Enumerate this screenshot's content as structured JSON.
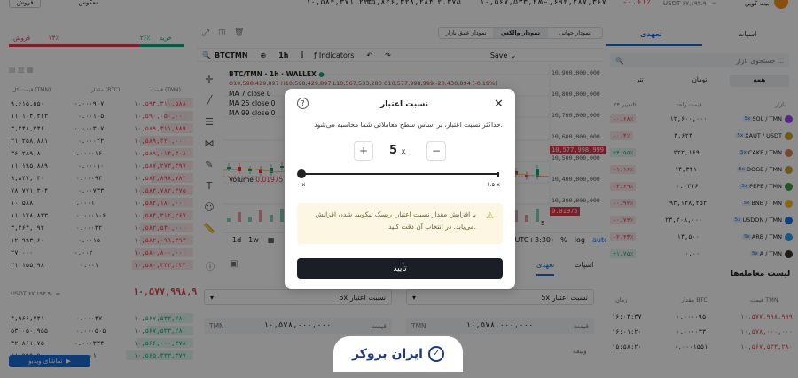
{
  "top_bar": {
    "left_btn1": "فروش",
    "left_btn2": "معکوس",
    "price1": "۱۰,۵۸۴,۳۷۱,۲۲۵",
    "price2": "۳۵,۸۲۶,۳۲۸,۲۸۴",
    "price3": "۲.۳۷۵",
    "price4": "۱۰,۵۶۷,۵۳۳,۲۸۰",
    "price5": "۱۰,۶۹۲,۲۸۷,۳۶۷",
    "change": "-۰.۶۱٪",
    "usdt_label": "USDT ۶۷,۱۹۳.۹۰ ≈",
    "pair_name": "بیت کوین",
    "pair_sub": "تومان /"
  },
  "orderbook": {
    "buy_label": "خرید",
    "sell_label": "فروش",
    "buy_pct": "۲۶٪",
    "sell_pct": "۷۴٪",
    "col_price": "قیمت (TMN)",
    "col_amount": "مقدار (BTC)",
    "col_total": "قیمت کل (TMN)",
    "asks": [
      [
        "۱۰,۵۹۴,۳۱۰,۵۸۸",
        "۰.۰۰۰۹۰۷",
        "۹,۶۱۵,۵۵۰"
      ],
      [
        "۱۰,۵۹۰,۰۵۰,۰۰۰",
        "۰.۰۰۱۰۵",
        "۱۱,۱۰۴,۳۶۳"
      ],
      [
        "۱۰,۵۸۹,۳۱۱,۸۸۹",
        "۰.۰۰۰۳۰۷",
        "۳,۲۴۸,۳۴۶"
      ],
      [
        "۱۰,۵۸۹,۲۲۰,۰۰۰",
        "۰.۰۰۰۲۲",
        "۲۱,۲۵۸,۸۸۱"
      ],
      [
        "۱۰,۵۸۹,۰۱۴,۳۰۸",
        "۰.۰۰۰۰۱۶",
        "۳۶,۲۸۹,۸"
      ],
      [
        "۱۰,۵۸۷,۲۷۳,۳۹۷",
        "۰.۰۰۰۱۰",
        "۱۱,۱۹۵,۸۸۹"
      ],
      [
        "۱۰,۵۸۴,۸۹۸,۷۸۲",
        "۰.۰۰۰۹۳",
        "۹,۸۴۷,۱۳۰"
      ],
      [
        "۱۰,۵۸۴,۷۸۲,۳۷۵",
        "۰.۰۰۷۳۳",
        "۷۸,۷۷۱,۳۰۴"
      ],
      [
        "۱۰,۵۸۴,۱۸۰,۰۰۰",
        "۰.۰۰۰۱",
        "۱۰,۵۸۸"
      ],
      [
        "۱۰,۵۸۴,۳۱۲,۲۶۷",
        "۰.۰۰۰۱۰۶",
        "۱۱,۱۷۸,۸۳۳"
      ],
      [
        "۱۰,۵۸۲,۵۴۰,۰۰۰",
        "۰.۰۰۰۳۲",
        "۳,۲۶۴,۰۹۲"
      ],
      [
        "۱۰,۵۸۲,۰۹۹,۳۹۴",
        "۰.۰۰۱۵",
        "۱۲,۹۹۳,۶۰"
      ],
      [
        "۱۰,۵۸۰,۸۰۰,۰۰۰",
        "۰.۰۰۲",
        "۲۷,۰۰۰"
      ],
      [
        "۱۰,۵۸۰,۳۳۳,۳۳۳",
        "۰.۰۰۱",
        "۲۱,۱۵۵,۹۸"
      ]
    ],
    "last_price": "۱۰,۵۷۷,۹۹۸,۹۹۹",
    "last_usdt": "USDT ۶۷,۱۹۳.۹۰ ≈",
    "bids": [
      [
        "۱۰,۵۶۷,۵۳۳,۲۸۰",
        "۰.۰۰۰۴۷",
        "۴,۹۶۶,۷۴۱"
      ],
      [
        "۱۰,۵۶۷,۵۳۳,۲۸۰",
        "۰.۰۰۰۵۰۵",
        "۵۳,۰۵۰,۹۵۵"
      ],
      [
        "۱۰,۵۶۶,۰۰۰,۳۷۸",
        "۰.۰۰۰۳۳۴",
        "۳۲,۸۶۱,۷۵"
      ],
      [
        "۱۰,۵۶۵,۳۳۳,۳۷۷",
        "۰.۰۰۱",
        "۸۱,۹۹۹,۹"
      ]
    ],
    "watch_btn": "تماشای ویدیو"
  },
  "chart": {
    "view_tabs": [
      "نمودار جهانی",
      "نمودار والکس",
      "نمودار عمق بازار"
    ],
    "active_view": "نمودار والکس",
    "symbol": "BTCTMN",
    "interval": "1h",
    "indicators": "Indicators",
    "save": "Save",
    "title": "BTC/TMN · 1h · WALLEX",
    "ohlc": "O10,598,429,897 H10,598,429,897 L10,567,533,280 C10,577,998,999 -20,430,894 (-0.19%)",
    "ma7": "MA 7 close 0",
    "ma25": "MA 25 close 0",
    "ma99": "MA 99 close 0",
    "volume": "Volume",
    "volume_val": "0.01975",
    "vol_tag": "0.01975",
    "price_axis": [
      "10,900,000,000",
      "10,800,000,000",
      "10,700,000,000",
      "10,600,000,000",
      "10,500,000,000",
      "10,400,000,000",
      "10,300,000,000"
    ],
    "price_tag": "10,577,998,999",
    "axis_5": "5",
    "ranges": [
      "1d",
      "1w"
    ],
    "time_label": "(UTC+3:30)",
    "pct": "%",
    "log": "log",
    "auto": "auto"
  },
  "market": {
    "tabs": [
      "اسپات",
      "تعهدی"
    ],
    "active_tab": "تعهدی",
    "search_placeholder": "جستجوی بازار ...",
    "quote_tabs": [
      "همه",
      "تومان",
      "تتر"
    ],
    "col_market": "بازار",
    "col_price": "قیمت واحد",
    "col_change": "تغییر ۲۴h",
    "rows": [
      {
        "sym": "SOL / TMN",
        "price": "۱۲,۶۰۰,۰۰۰",
        "chg": "-۰.۶۸٪",
        "pos": false,
        "color": "#9945ff"
      },
      {
        "sym": "XAUT / USDT",
        "price": "۴,۶۲۴",
        "chg": "-۰.۳٪",
        "pos": false,
        "color": "#c9a227"
      },
      {
        "sym": "CAKE / TMN",
        "price": "۲۲۲,۱۶۹",
        "chg": "+۴.۵۵٪",
        "pos": true,
        "color": "#d1884f"
      },
      {
        "sym": "DOGE / TMN",
        "price": "۱۴,۳۴۱",
        "chg": "-۱.۱۶٪",
        "pos": false,
        "color": "#c2a633"
      },
      {
        "sym": "PEPE / TMN",
        "price": "۰.۰۳۷۶",
        "chg": "-۳.۶۹٪",
        "pos": false,
        "color": "#3d9c3d"
      },
      {
        "sym": "BNB / TMN",
        "price": "۹۳,۱۴۸,۴۵۴",
        "chg": "-۰.۹۲٪",
        "pos": false,
        "color": "#f3ba2f"
      },
      {
        "sym": "USDON / TMN",
        "price": "۲۳,۲۰۸,۰۰۰",
        "chg": "-۰.۷۴٪",
        "pos": false,
        "color": "#1a73e8"
      },
      {
        "sym": "ARB / TMN",
        "price": "۱۴,۵۰۰",
        "chg": "-۲.۴۳٪",
        "pos": false,
        "color": "#28a0f0"
      },
      {
        "sym": "A / TMN",
        "price": "۰.۰۰",
        "chg": "+۱.۷۵٪",
        "pos": true,
        "color": "#333"
      }
    ]
  },
  "trades": {
    "title": "لیست معامله‌ها",
    "col_price": "قیمت TMN",
    "col_amount": "مقدار BTC",
    "col_time": "زمان",
    "rows": [
      [
        "۱۰,۵۷۷,۹۹۸,۹۹۹",
        "۰.۰۰۰۰۹۵",
        "۱۶:۰۴:۳۷"
      ],
      [
        "۱۰,۵۷۸,۰۰۰,۰۰۰",
        "۰.۰۰۰۰۳۳",
        "۱۶:۰۱:۲۰"
      ],
      [
        "۱۰,۵۶۷,۵۳۳,۲۸۰",
        "۰.۰۰۰۱۵۵۱",
        "۱۵:۵۸:۲۰"
      ]
    ]
  },
  "order_form": {
    "tabs": [
      "اسپات",
      "تعهدی"
    ],
    "active_tab": "تعهدی",
    "leverage_label": "نسبت اعتبار",
    "leverage_val": "5x",
    "price_label": "قیمت",
    "price_val": "۱۰,۵۷۸,۰۰۰,۰۰۰",
    "currency": "TMN",
    "collateral_label": "وثیقه"
  },
  "modal": {
    "title": "نسبت اعتبار",
    "description": "حداکثر نسبت اعتبار، بر اساس سطح معاملاتی شما محاسبه می‌شود.",
    "value": "5",
    "unit": "x",
    "plus": "+",
    "minus": "−",
    "min_label": "۰ x",
    "max_label": "۱.۵ x",
    "warning": "با افزایش مقدار نسبت اعتبار، ریسک لیکویید شدن افزایش می‌یابد. در انتخاب آن دقت کنید.",
    "confirm": "تأیید",
    "slider_fraction": 0
  },
  "watermark": {
    "text": "ایران بروکر"
  }
}
